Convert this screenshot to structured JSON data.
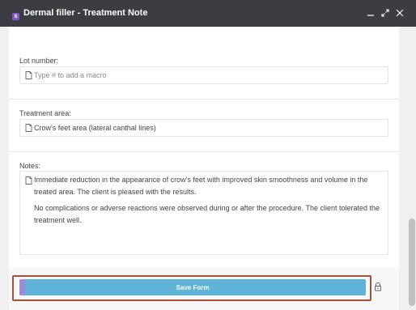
{
  "window": {
    "title": "Dermal filler - Treatment Note",
    "badge_icon": "app-badge-icon",
    "badge_color": "#7e57c2",
    "titlebar_color": "#3b3d42",
    "controls": [
      "minimize-icon",
      "maximize-icon",
      "close-icon"
    ]
  },
  "form": {
    "lot_number": {
      "label": "Lot number:",
      "value": "",
      "placeholder": "Type # to add a macro"
    },
    "treatment_area": {
      "label": "Treatment area:",
      "value": "Crow's feet area (lateral canthal lines)"
    },
    "notes": {
      "label": "Notes:",
      "paragraphs": [
        "Immediate reduction in the appearance of crow's feet with improved skin smoothness and volume in the treated area. The client is pleased with the results.",
        "No complications or adverse reactions were observed during or after the procedure. The client tolerated the treatment well."
      ]
    }
  },
  "footer": {
    "save_label": "Save Form",
    "save_color": "#5eb3d6",
    "highlight_color": "#a3533a",
    "lock_icon": "lock-icon"
  }
}
